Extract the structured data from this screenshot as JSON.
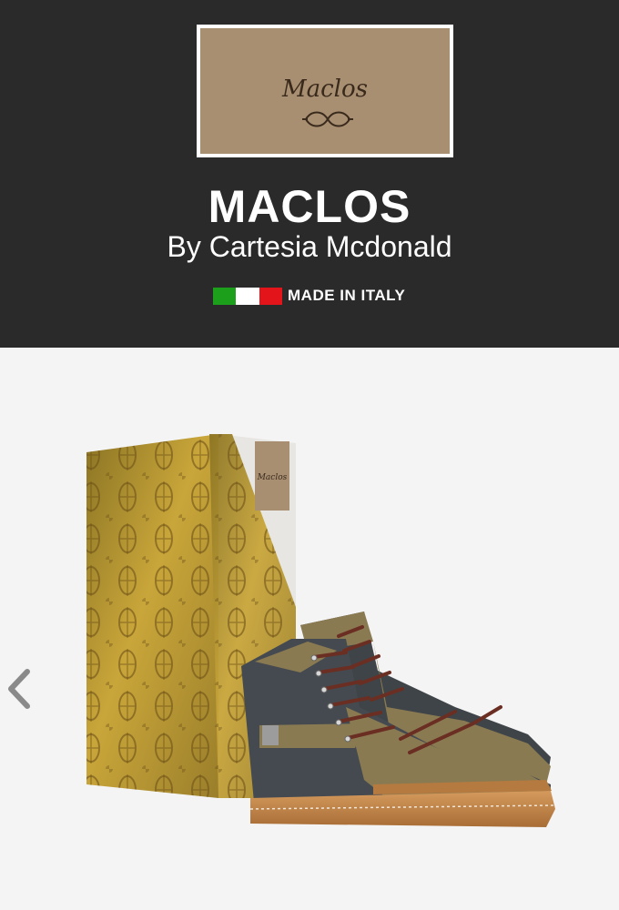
{
  "logo": {
    "text": "Maclos"
  },
  "header": {
    "title": "MACLOS",
    "byline": "By Cartesia Mcdonald",
    "made_in": "MADE IN ITALY",
    "flag_colors": [
      "#1ca01c",
      "#ffffff",
      "#e4141b"
    ]
  },
  "box_label": {
    "text": "Maclos"
  },
  "carousel": {
    "prev_icon": "chevron-left-icon"
  },
  "colors": {
    "header_bg": "#2a2a2a",
    "logo_bg": "#a88f72",
    "page_bg": "#f4f4f4",
    "box_gold": "#b8932c"
  }
}
